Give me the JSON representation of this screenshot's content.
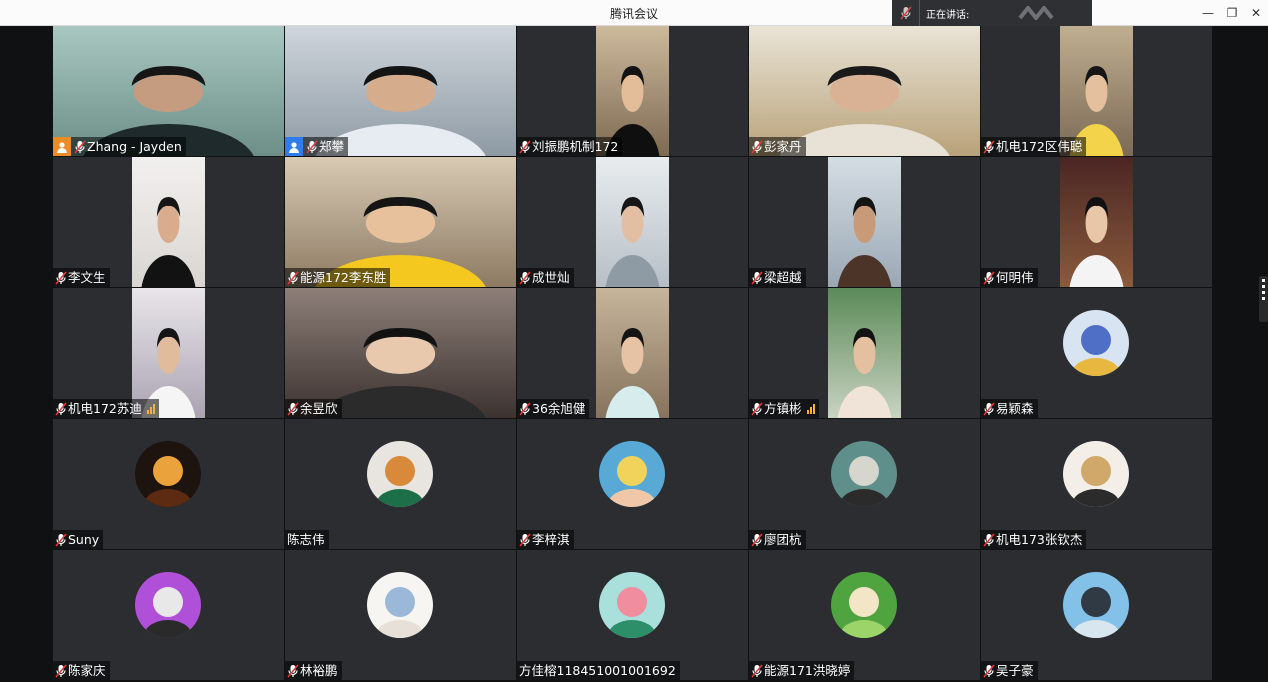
{
  "window": {
    "title": "腾讯会议"
  },
  "speaking": {
    "label": "正在讲话:"
  },
  "controls": {
    "minimize": "—",
    "restore": "❐",
    "close": "✕"
  },
  "participants": [
    {
      "name": "Zhang - Jayden",
      "host": "orange",
      "video": "full",
      "bg": [
        "#a9c7c1",
        "#6c8f88"
      ],
      "face": "#c59c7f",
      "shirt": "#1f2a2c",
      "hair": "#161616"
    },
    {
      "name": "郑攀",
      "host": "blue",
      "video": "full",
      "bg": [
        "#cfd6dc",
        "#8e9aa4"
      ],
      "face": "#d6ad8c",
      "shirt": "#e6ecf2",
      "hair": "#141414"
    },
    {
      "name": "刘振鹏机制172",
      "video": "narrow",
      "bg": [
        "#cdb99c",
        "#7d6a52"
      ],
      "face": "#e3bc9a",
      "shirt": "#0f0f0f",
      "hair": "#131313"
    },
    {
      "name": "彭家丹",
      "video": "full",
      "bg": [
        "#e9e4d6",
        "#b9a27a"
      ],
      "face": "#d9b296",
      "shirt": "#e8e2d6",
      "hair": "#1a1a1a"
    },
    {
      "name": "机电172区伟聪",
      "video": "narrow",
      "bg": [
        "#bfae90",
        "#7b6a55"
      ],
      "face": "#e4c09f",
      "shirt": "#f2d34a",
      "hair": "#151515"
    },
    {
      "name": "李文生",
      "video": "narrow",
      "bg": [
        "#f2f0ee",
        "#d9d6d2"
      ],
      "face": "#d8ac8c",
      "shirt": "#121212",
      "hair": "#151515"
    },
    {
      "name": "能源172李东胜",
      "video": "full",
      "bg": [
        "#d8cab3",
        "#8d7a63"
      ],
      "face": "#e6c19c",
      "shirt": "#f4c81f",
      "hair": "#151515"
    },
    {
      "name": "成世灿",
      "video": "narrow",
      "bg": [
        "#e8ecef",
        "#b7bfc6"
      ],
      "face": "#e2bfa2",
      "shirt": "#8e9aa4",
      "hair": "#161616"
    },
    {
      "name": "梁超越",
      "video": "narrow",
      "bg": [
        "#d5dde4",
        "#9aa8b4"
      ],
      "face": "#c89a78",
      "shirt": "#4c3528",
      "hair": "#141414"
    },
    {
      "name": "何明伟",
      "video": "narrow",
      "bg": [
        "#4a2623",
        "#8a5a3c"
      ],
      "face": "#e8c6a8",
      "shirt": "#f4f4f4",
      "hair": "#111111"
    },
    {
      "name": "机电172苏迪",
      "video": "narrow",
      "signal": true,
      "bg": [
        "#e9e6ea",
        "#a9a3b2"
      ],
      "face": "#e0bb9c",
      "shirt": "#f5f5f5",
      "hair": "#151515"
    },
    {
      "name": "余昱欣",
      "video": "full",
      "bg": [
        "#8d7f78",
        "#3c3230"
      ],
      "face": "#e9c9ae",
      "shirt": "#2b2b2b",
      "hair": "#121212"
    },
    {
      "name": "36余旭健",
      "video": "narrow",
      "bg": [
        "#c6b59b",
        "#85735d"
      ],
      "face": "#e6c3a4",
      "shirt": "#d7ecec",
      "hair": "#141414"
    },
    {
      "name": "方镇彬",
      "video": "narrow",
      "signal": true,
      "bg": [
        "#5b8a58",
        "#c9d3c2"
      ],
      "face": "#e5c0a0",
      "shirt": "#f0e4d8",
      "hair": "#131313"
    },
    {
      "name": "易颖森",
      "avatar": [
        "#d8e4f2",
        "#4f6fc7",
        "#e7b740"
      ]
    },
    {
      "name": "Suny",
      "avatar": [
        "#1d1410",
        "#e9a23c",
        "#5d2a12"
      ]
    },
    {
      "name": "陈志伟",
      "video": "none",
      "nomic": true,
      "avatar": [
        "#e8e5e1",
        "#d88a3a",
        "#1d6f4a"
      ]
    },
    {
      "name": "李梓淇",
      "avatar": [
        "#58a9d6",
        "#f1d35c",
        "#f0c7a8"
      ]
    },
    {
      "name": "廖团杭",
      "avatar": [
        "#5f8f8a",
        "#d6d6cf",
        "#2b2b2b"
      ]
    },
    {
      "name": "机电173张钦杰",
      "avatar": [
        "#f3efe8",
        "#cfa86a",
        "#2b2b2b"
      ]
    },
    {
      "name": "陈家庆",
      "avatar": [
        "#b04fd8",
        "#e8e8e8",
        "#2a2a2a"
      ]
    },
    {
      "name": "林裕鹏",
      "avatar": [
        "#f7f5f2",
        "#9bb8d8",
        "#e6e0d8"
      ]
    },
    {
      "name": "方佳榕118451001001692",
      "nomic": true,
      "avatar": [
        "#a9e0dc",
        "#f08ea0",
        "#2d8f6a"
      ]
    },
    {
      "name": "能源171洪晓婷",
      "avatar": [
        "#4fa43f",
        "#f2e6c6",
        "#9cd46a"
      ]
    },
    {
      "name": "吴子豪",
      "avatar": [
        "#83c1e8",
        "#2f3a45",
        "#d7e6ef"
      ]
    }
  ]
}
